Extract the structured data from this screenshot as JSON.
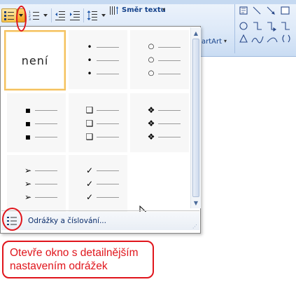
{
  "ribbon": {
    "text_direction_label": "Směr textu",
    "text_direction_arrow": "▾",
    "smartart_label": "artArt",
    "smartart_arrow": "▾"
  },
  "bullet_gallery": {
    "none_label": "není",
    "cells": [
      {
        "id": "none"
      },
      {
        "id": "small-dot",
        "glyph": "•"
      },
      {
        "id": "hollow-circle",
        "glyph": "○"
      },
      {
        "id": "filled-square",
        "glyph": "▪"
      },
      {
        "id": "hollow-square",
        "glyph": "❑"
      },
      {
        "id": "diamond-cluster",
        "glyph": "❖"
      },
      {
        "id": "arrowhead",
        "glyph": "➢"
      },
      {
        "id": "checkmark",
        "glyph": "✓"
      }
    ],
    "scroll_up": "▲",
    "scroll_down": "▼"
  },
  "footer": {
    "label": "Odrážky a číslování...",
    "grip": "⋰"
  },
  "annotation": {
    "line1": "Otevře okno s detailnějším",
    "line2": "nastavením odrážek",
    "color": "#e0151c"
  },
  "colors": {
    "selected_border": "#f4c05e",
    "ribbon_text": "#15428b"
  }
}
